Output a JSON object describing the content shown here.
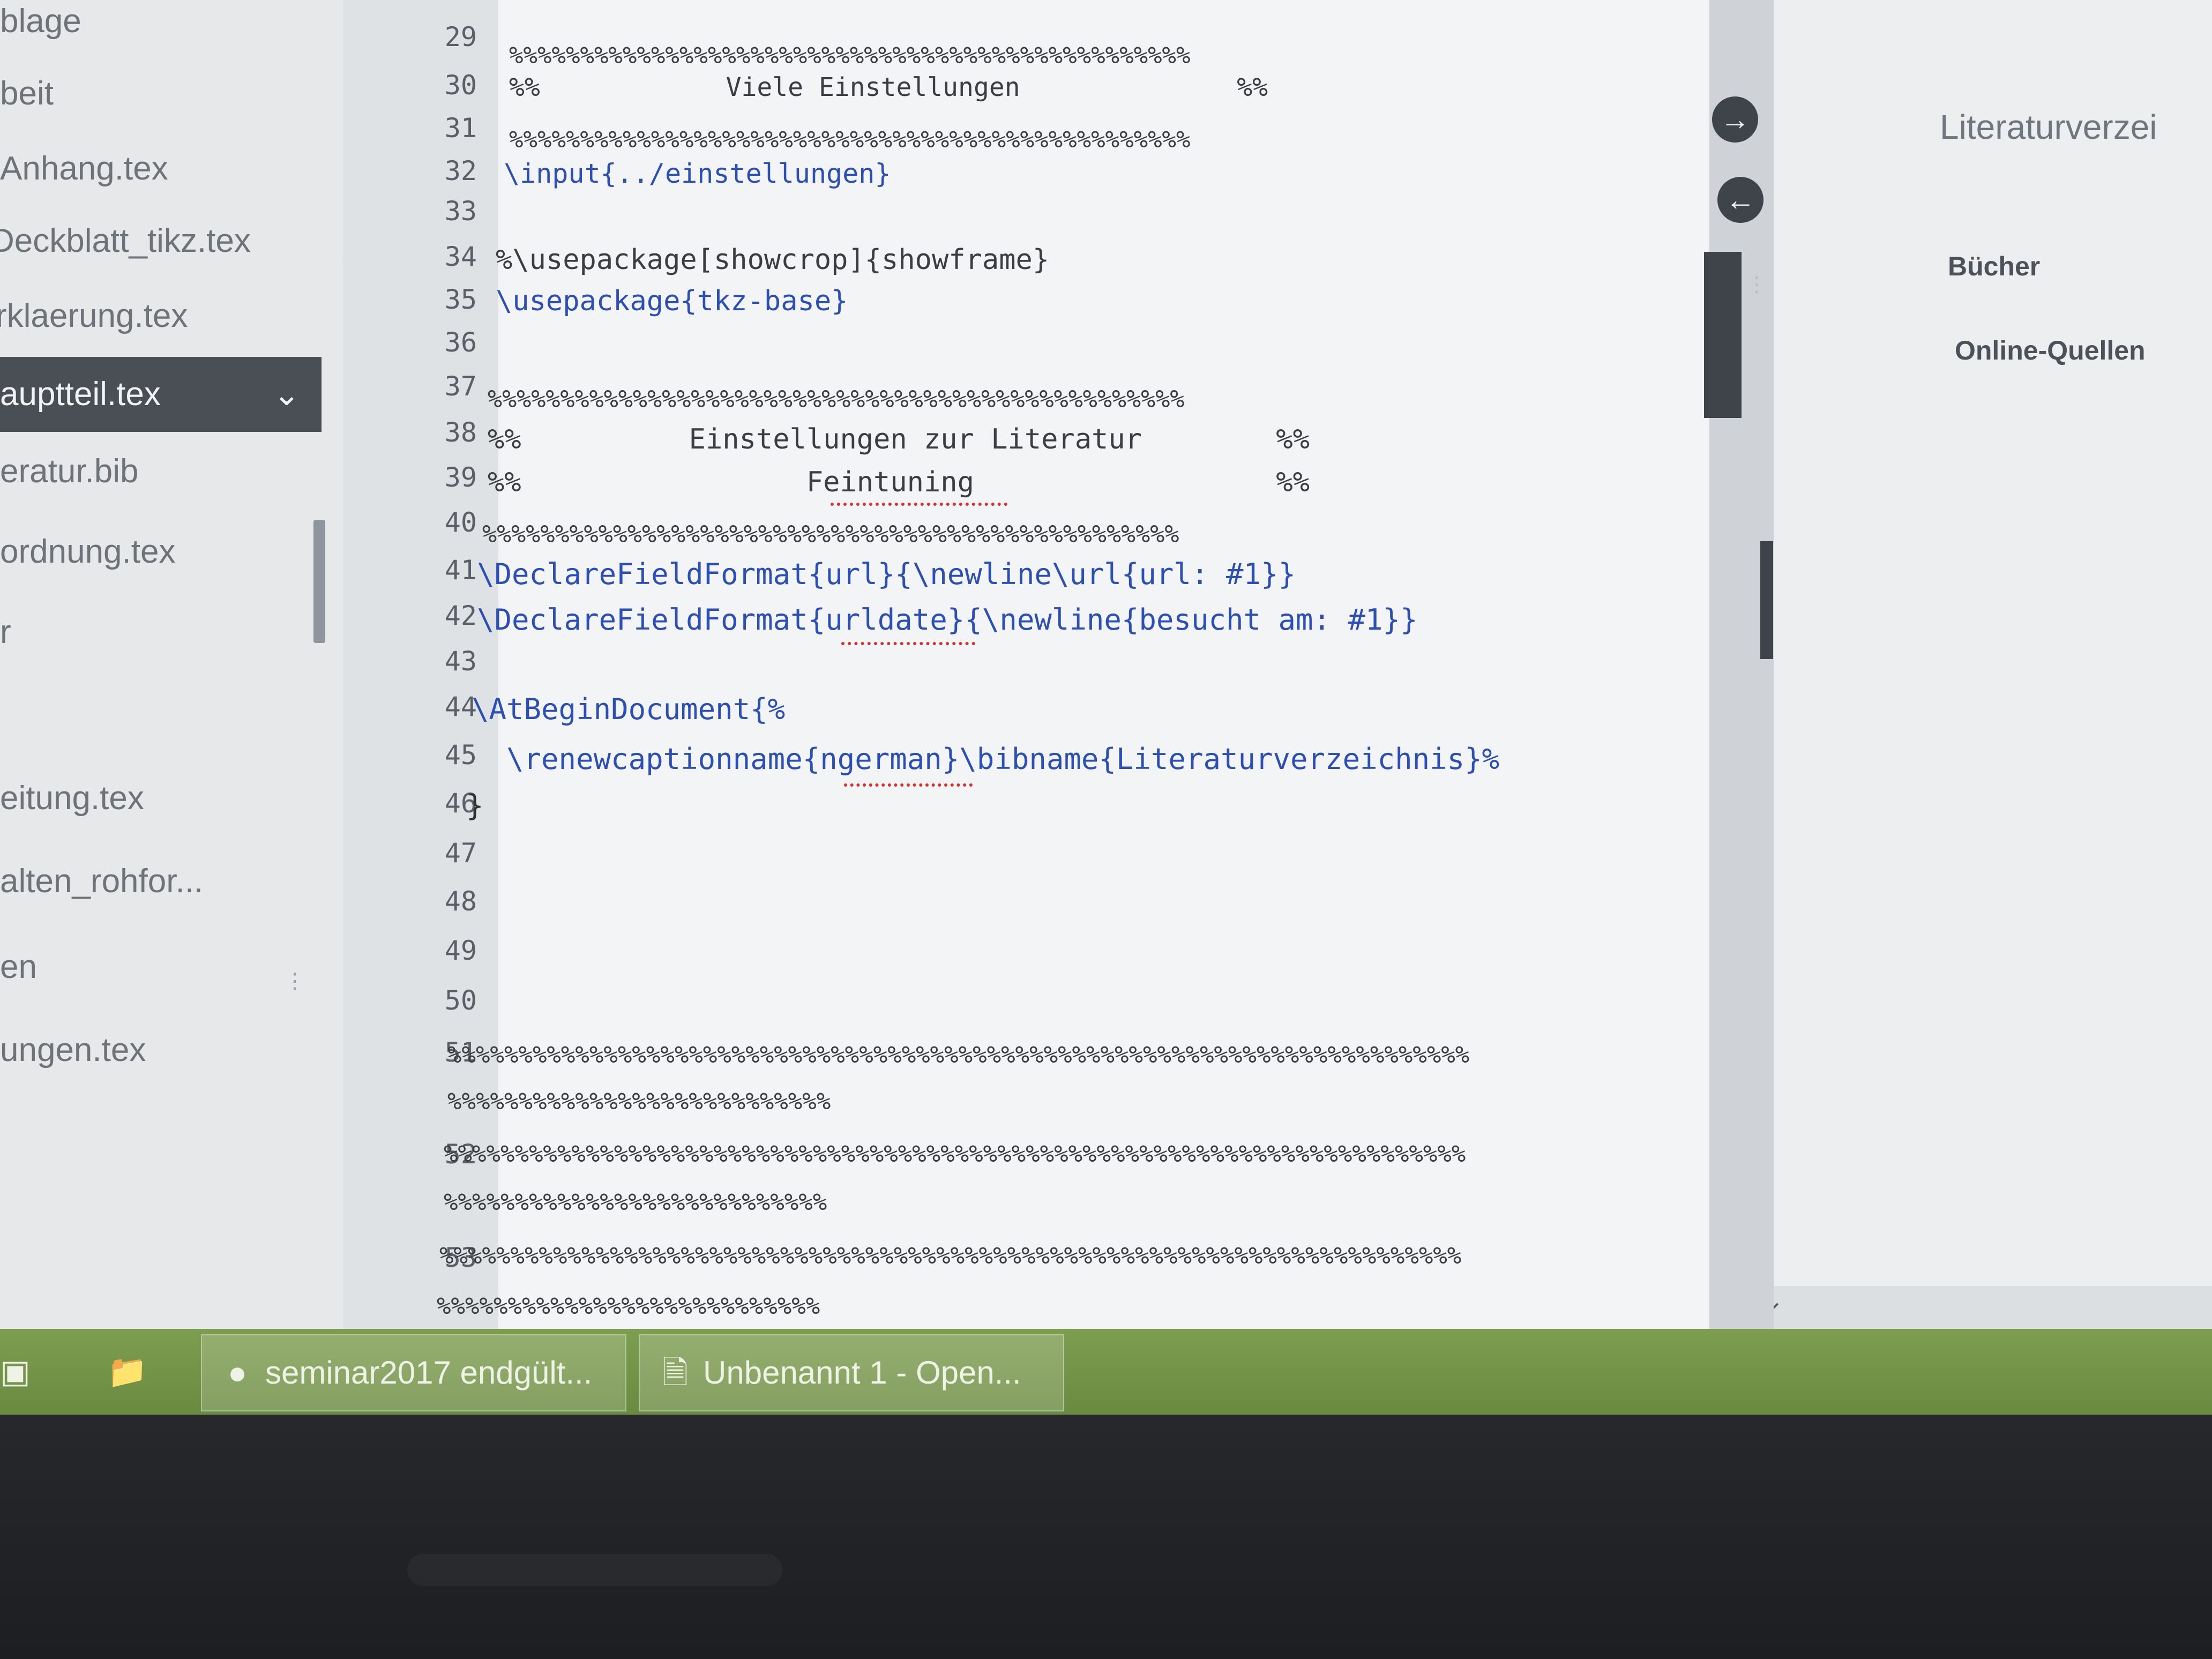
{
  "file_panel": {
    "items": [
      {
        "label": "blage",
        "active": false
      },
      {
        "label": "beit",
        "active": false
      },
      {
        "label": "Anhang.tex",
        "active": false
      },
      {
        "label": "Deckblatt_tikz.tex",
        "active": false
      },
      {
        "label": "rklaerung.tex",
        "active": false
      },
      {
        "label": "auptteil.tex",
        "active": true
      },
      {
        "label": "eratur.bib",
        "active": false
      },
      {
        "label": "ordnung.tex",
        "active": false
      },
      {
        "label": "r",
        "active": false
      },
      {
        "label": "eitung.tex",
        "active": false
      },
      {
        "label": "alten_rohfor...",
        "active": false
      },
      {
        "label": "en",
        "active": false
      },
      {
        "label": "ungen.tex",
        "active": false
      }
    ],
    "active_chevron": "chevron-down-icon"
  },
  "editor": {
    "lines": [
      {
        "no": "29",
        "text": "%%%%%%%%%%%%%%%%%%%%%%%%%%%%%%%%%%%%%%%%%%%%%%%%"
      },
      {
        "no": "30",
        "text": "%%            Viele Einstellungen              %%"
      },
      {
        "no": "31",
        "text": "%%%%%%%%%%%%%%%%%%%%%%%%%%%%%%%%%%%%%%%%%%%%%%%%"
      },
      {
        "no": "32",
        "text": "\\input{../einstellungen}"
      },
      {
        "no": "33",
        "text": ""
      },
      {
        "no": "34",
        "text": "%\\usepackage[showcrop]{showframe}"
      },
      {
        "no": "35",
        "text": "\\usepackage{tkz-base}"
      },
      {
        "no": "36",
        "text": ""
      },
      {
        "no": "37",
        "text": "%%%%%%%%%%%%%%%%%%%%%%%%%%%%%%%%%%%%%%%%%%%%%%%%"
      },
      {
        "no": "38",
        "text": "%%          Einstellungen zur Literatur        %%"
      },
      {
        "no": "39",
        "text": "%%                 Feintuning                  %%"
      },
      {
        "no": "40",
        "text": "%%%%%%%%%%%%%%%%%%%%%%%%%%%%%%%%%%%%%%%%%%%%%%%%"
      },
      {
        "no": "41",
        "text": "\\DeclareFieldFormat{url}{\\newline\\url{url: #1}}"
      },
      {
        "no": "42",
        "text": "\\DeclareFieldFormat{urldate}{\\newline{besucht am: #1}}"
      },
      {
        "no": "43",
        "text": ""
      },
      {
        "no": "44",
        "text": "\\AtBeginDocument{%"
      },
      {
        "no": "45",
        "text": "  \\renewcaptionname{ngerman}\\bibname{Literaturverzeichnis}%"
      },
      {
        "no": "46",
        "text": "}"
      },
      {
        "no": "47",
        "text": ""
      },
      {
        "no": "48",
        "text": ""
      },
      {
        "no": "49",
        "text": ""
      },
      {
        "no": "50",
        "text": ""
      },
      {
        "no": "51",
        "text": "%%%%%%%%%%%%%%%%%%%%%%%%%%%%%%%%%%%%%%%%%%%%%%%%%%%%%%%%%%%%%%%%%%%%%%%%"
      },
      {
        "no": "",
        "text": "%%%%%%%%%%%%%%%%%%%%%%%%%%%"
      },
      {
        "no": "52",
        "text": "%%%%%%%%%%%%%%%%%%%%%%%%%%%%%%%%%%%%%%%%%%%%%%%%%%%%%%%%%%%%%%%%%%%%%%%%"
      },
      {
        "no": "",
        "text": "%%%%%%%%%%%%%%%%%%%%%%%%%%%"
      },
      {
        "no": "53",
        "text": "%%%%%%%%%%%%%%%%%%%%%%%%%%%%%%%%%%%%%%%%%%%%%%%%%%%%%%%%%%%%%%%%%%%%%%%%"
      },
      {
        "no": "",
        "text": "%%%%%%%%%%%%%%%%%%%%%%%%%%%"
      }
    ],
    "colors": {
      "command": "#2b4fb4",
      "text": "#2e3134",
      "spell_error": "#d8312b"
    }
  },
  "outline": {
    "title": "Literaturverzei",
    "items": [
      "Bücher",
      "Online-Quellen"
    ],
    "forward_icon": "arrow-right-icon",
    "back_icon": "arrow-left-icon"
  },
  "taskbar": {
    "buttons": [
      {
        "label": "seminar2017 endgült...",
        "icon": "firefox-icon"
      },
      {
        "label": "Unbenannt 1 - Open...",
        "icon": "document-icon"
      }
    ],
    "color": "#7d9e4f"
  }
}
